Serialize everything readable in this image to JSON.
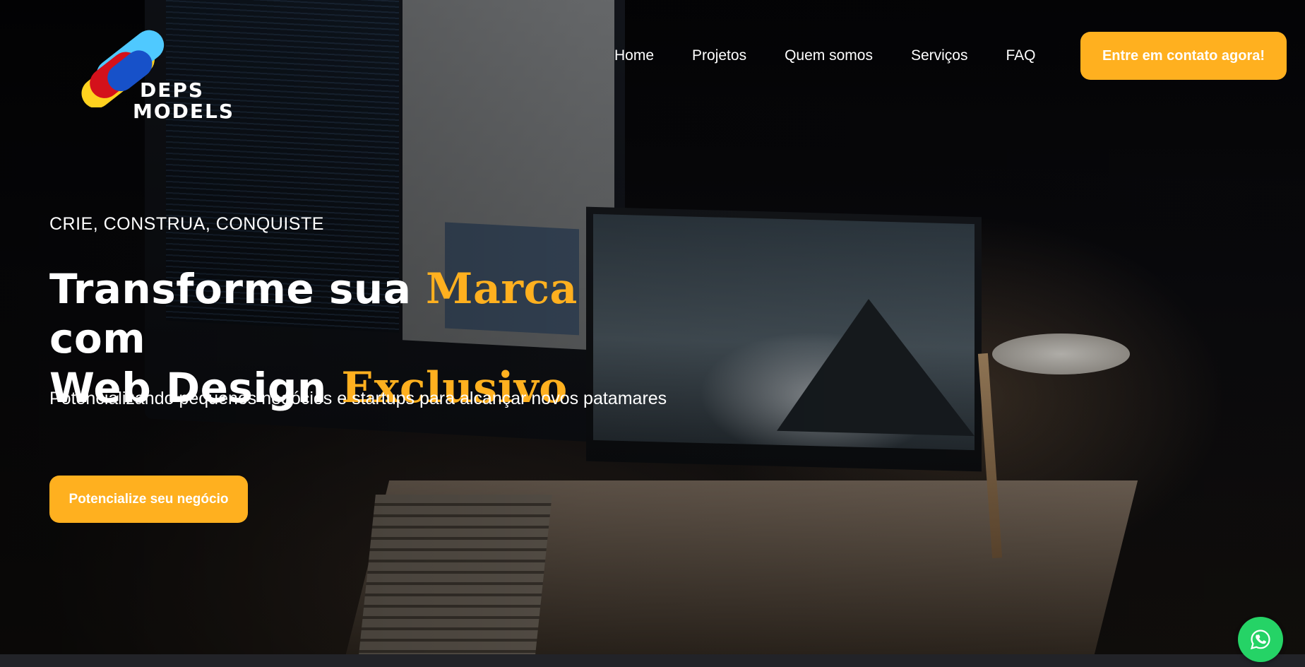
{
  "brand": {
    "logo_line1": "DEPS",
    "logo_line2": "MODELS",
    "colors": {
      "yellow": "#ffd21f",
      "red": "#d4111b",
      "blue": "#1751c9",
      "light_blue": "#4fc9ff"
    }
  },
  "nav": {
    "items": [
      {
        "label": "Home"
      },
      {
        "label": "Projetos"
      },
      {
        "label": "Quem somos"
      },
      {
        "label": "Serviços"
      },
      {
        "label": "FAQ"
      }
    ],
    "cta_label": "Entre em contato agora!"
  },
  "hero": {
    "eyebrow": "CRIE, CONSTRUA, CONQUISTE",
    "headline": {
      "part1": "Transforme sua ",
      "accent1": "Marca",
      "part2": " com",
      "part3": "Web Design ",
      "accent2": "Exclusivo"
    },
    "subhead": "Potencializando pequenos negócios e startups para alcançar novos patamares",
    "cta_label": "Potencialize seu negócio"
  },
  "floating": {
    "icon": "whatsapp-icon"
  },
  "theme": {
    "accent": "#ffb01f",
    "whatsapp": "#25d366"
  }
}
